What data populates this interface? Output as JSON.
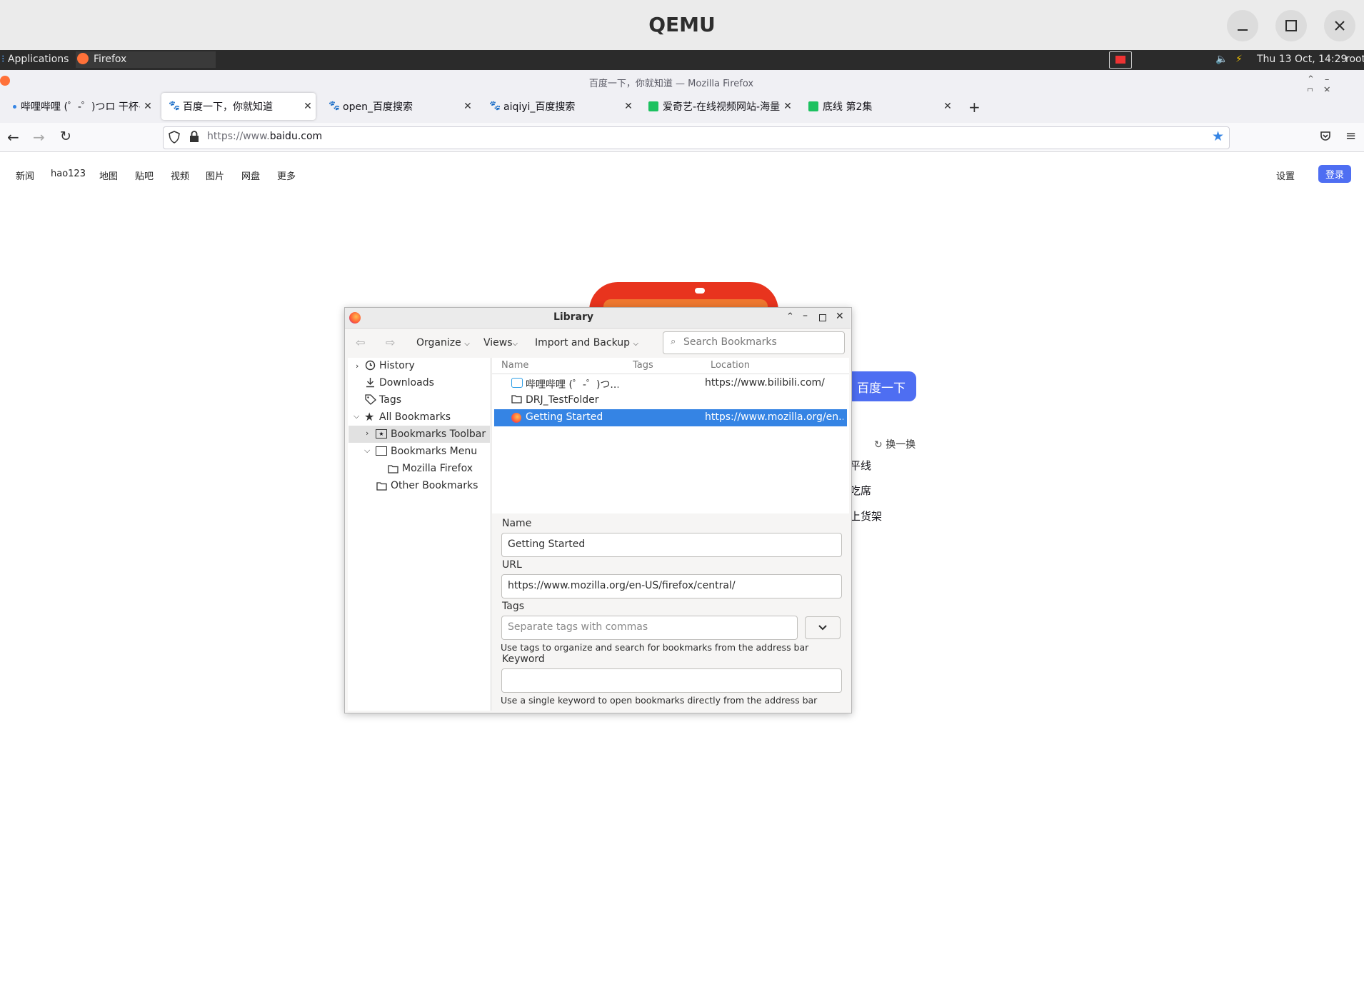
{
  "qemu": {
    "title": "QEMU"
  },
  "panel": {
    "applications": "Applications",
    "firefox_task": "Firefox",
    "datetime": "Thu 13 Oct, 14:29",
    "user": "root"
  },
  "firefox": {
    "window_title": "百度一下，你就知道 — Mozilla Firefox",
    "tabs": [
      {
        "label": "哔哩哔哩 (゜-゜)つロ 干杯~"
      },
      {
        "label": "百度一下，你就知道"
      },
      {
        "label": "open_百度搜索"
      },
      {
        "label": "aiqiyi_百度搜索"
      },
      {
        "label": "爱奇艺-在线视频网站-海量正"
      },
      {
        "label": "底线 第2集"
      }
    ],
    "url_prefix": "https://www.",
    "url_domain": "baidu.com"
  },
  "baidu": {
    "nav": [
      "新闻",
      "hao123",
      "地图",
      "贴吧",
      "视频",
      "图片",
      "网盘",
      "更多"
    ],
    "settings": "设置",
    "login": "登录",
    "search_button": "百度一下",
    "refresh": "换一换",
    "hot": [
      "平线",
      "吃席",
      "上货架"
    ]
  },
  "library": {
    "title": "Library",
    "toolbar": {
      "organize": "Organize",
      "views": "Views",
      "import_backup": "Import and Backup",
      "search_placeholder": "Search Bookmarks"
    },
    "tree": {
      "history": "History",
      "downloads": "Downloads",
      "tags": "Tags",
      "all_bookmarks": "All Bookmarks",
      "bookmarks_toolbar": "Bookmarks Toolbar",
      "bookmarks_menu": "Bookmarks Menu",
      "mozilla_firefox": "Mozilla Firefox",
      "other_bookmarks": "Other Bookmarks"
    },
    "columns": {
      "name": "Name",
      "tags": "Tags",
      "location": "Location"
    },
    "rows": [
      {
        "name": "哔哩哔哩 (゜-゜)つ...",
        "location": "https://www.bilibili.com/"
      },
      {
        "name": "DRJ_TestFolder",
        "location": ""
      },
      {
        "name": "Getting Started",
        "location": "https://www.mozilla.org/en..."
      }
    ],
    "details": {
      "name_label": "Name",
      "name_value": "Getting Started",
      "url_label": "URL",
      "url_value": "https://www.mozilla.org/en-US/firefox/central/",
      "tags_label": "Tags",
      "tags_placeholder": "Separate tags with commas",
      "tags_hint": "Use tags to organize and search for bookmarks from the address bar",
      "keyword_label": "Keyword",
      "keyword_value": "",
      "keyword_hint": "Use a single keyword to open bookmarks directly from the address bar"
    }
  },
  "colors": {
    "accent": "#3584e4",
    "baidu_blue": "#4e6ef2",
    "baidu_red": "#e8341e"
  }
}
